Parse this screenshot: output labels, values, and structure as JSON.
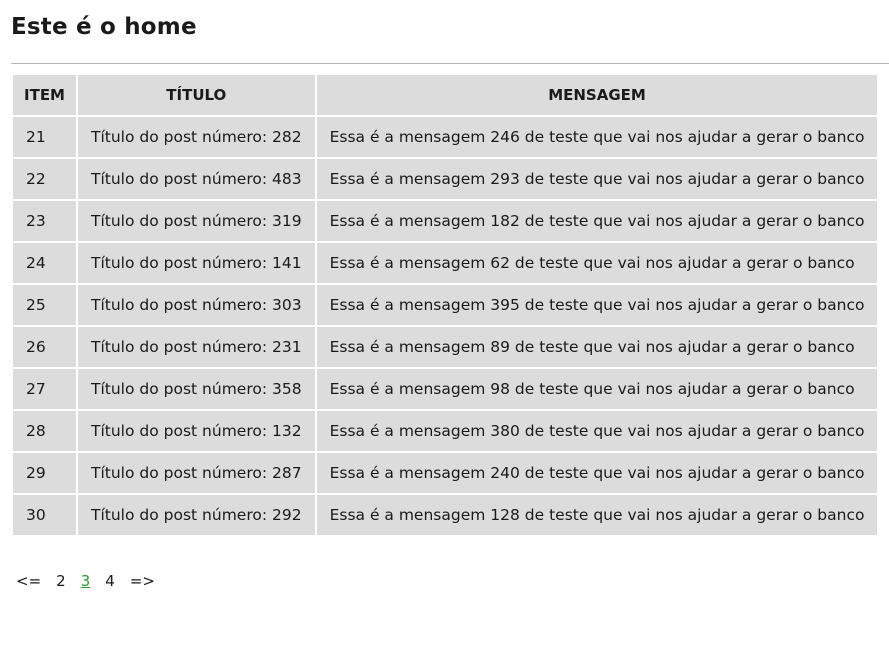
{
  "page": {
    "title": "Este é o home"
  },
  "table": {
    "headers": [
      "ITEM",
      "TÍTULO",
      "MENSAGEM"
    ],
    "rows": [
      {
        "item": "21",
        "titulo": "Título do post número: 282",
        "mensagem": "Essa é a mensagem 246 de teste que vai nos ajudar a gerar o banco"
      },
      {
        "item": "22",
        "titulo": "Título do post número: 483",
        "mensagem": "Essa é a mensagem 293 de teste que vai nos ajudar a gerar o banco"
      },
      {
        "item": "23",
        "titulo": "Título do post número: 319",
        "mensagem": "Essa é a mensagem 182 de teste que vai nos ajudar a gerar o banco"
      },
      {
        "item": "24",
        "titulo": "Título do post número: 141",
        "mensagem": "Essa é a mensagem 62 de teste que vai nos ajudar a gerar o banco"
      },
      {
        "item": "25",
        "titulo": "Título do post número: 303",
        "mensagem": "Essa é a mensagem 395 de teste que vai nos ajudar a gerar o banco"
      },
      {
        "item": "26",
        "titulo": "Título do post número: 231",
        "mensagem": "Essa é a mensagem 89 de teste que vai nos ajudar a gerar o banco"
      },
      {
        "item": "27",
        "titulo": "Título do post número: 358",
        "mensagem": "Essa é a mensagem 98 de teste que vai nos ajudar a gerar o banco"
      },
      {
        "item": "28",
        "titulo": "Título do post número: 132",
        "mensagem": "Essa é a mensagem 380 de teste que vai nos ajudar a gerar o banco"
      },
      {
        "item": "29",
        "titulo": "Título do post número: 287",
        "mensagem": "Essa é a mensagem 240 de teste que vai nos ajudar a gerar o banco"
      },
      {
        "item": "30",
        "titulo": "Título do post número: 292",
        "mensagem": "Essa é a mensagem 128 de teste que vai nos ajudar a gerar o banco"
      }
    ]
  },
  "pagination": {
    "prev": "<=",
    "pages": [
      "2",
      "3",
      "4"
    ],
    "current": "3",
    "next": "=>"
  },
  "colors": {
    "cell_bg": "#dcdcdc",
    "current_page": "#2e9b2e"
  }
}
